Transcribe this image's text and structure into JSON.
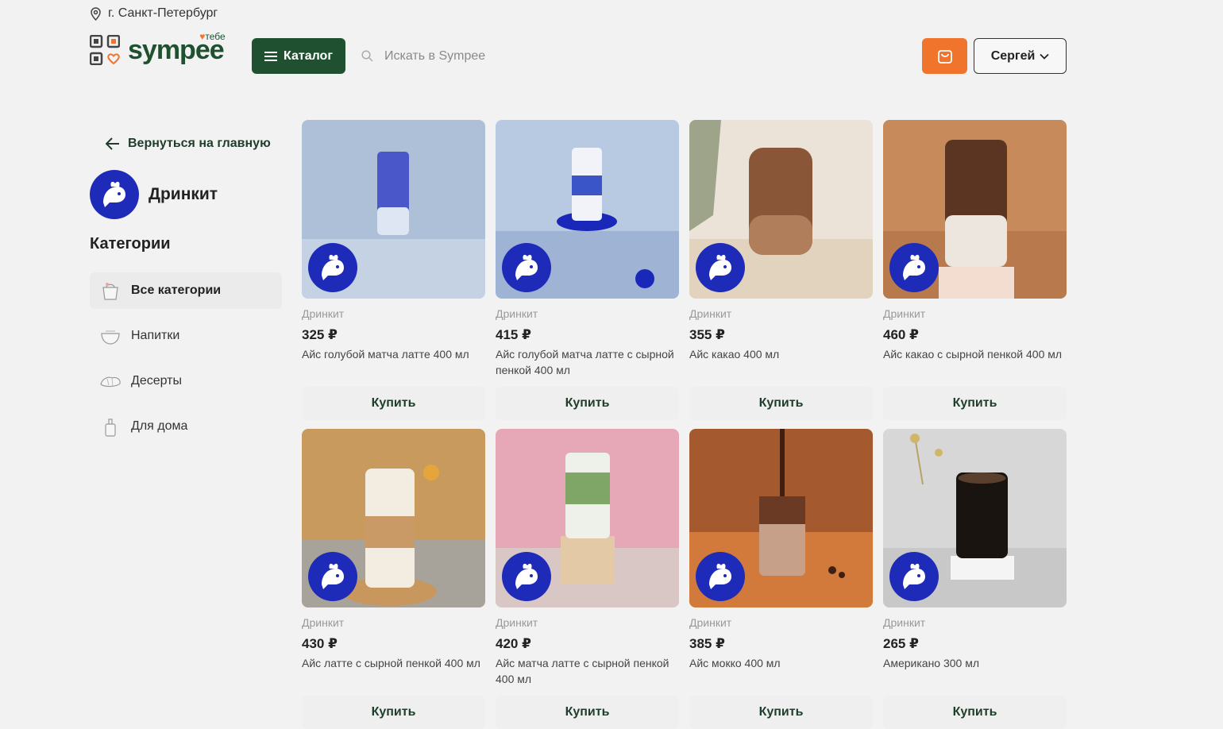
{
  "header": {
    "city": "г. Санкт-Петербург",
    "logo_text": "sympee",
    "logo_sup": "тебе",
    "catalog_label": "Каталог",
    "search_placeholder": "Искать в Sympee",
    "user_name": "Сергей"
  },
  "sidebar": {
    "back_label": "Вернуться на главную",
    "store_name": "Дринкит",
    "categories_title": "Категории",
    "categories": [
      {
        "label": "Все категории",
        "icon": "basket-icon",
        "active": true
      },
      {
        "label": "Напитки",
        "icon": "cup-icon",
        "active": false
      },
      {
        "label": "Десерты",
        "icon": "croissant-icon",
        "active": false
      },
      {
        "label": "Для дома",
        "icon": "bottle-icon",
        "active": false
      }
    ]
  },
  "products": [
    {
      "seller": "Дринкит",
      "price": "325 ₽",
      "title": "Айс голубой матча латте 400 мл",
      "buy": "Купить"
    },
    {
      "seller": "Дринкит",
      "price": "415 ₽",
      "title": "Айс голубой матча латте с сырной пенкой 400 мл",
      "buy": "Купить"
    },
    {
      "seller": "Дринкит",
      "price": "355 ₽",
      "title": "Айс какао 400 мл",
      "buy": "Купить"
    },
    {
      "seller": "Дринкит",
      "price": "460 ₽",
      "title": "Айс какао с сырной пенкой 400 мл",
      "buy": "Купить"
    },
    {
      "seller": "Дринкит",
      "price": "430 ₽",
      "title": "Айс латте с сырной пенкой 400 мл",
      "buy": "Купить"
    },
    {
      "seller": "Дринкит",
      "price": "420 ₽",
      "title": "Айс матча латте с сырной пенкой 400 мл",
      "buy": "Купить"
    },
    {
      "seller": "Дринкит",
      "price": "385 ₽",
      "title": "Айс мокко 400 мл",
      "buy": "Купить"
    },
    {
      "seller": "Дринкит",
      "price": "265 ₽",
      "title": "Американо 300 мл",
      "buy": "Купить"
    }
  ],
  "colors": {
    "brand_green": "#1f5130",
    "accent_orange": "#f0742b",
    "badge_blue": "#1e2bb8"
  }
}
